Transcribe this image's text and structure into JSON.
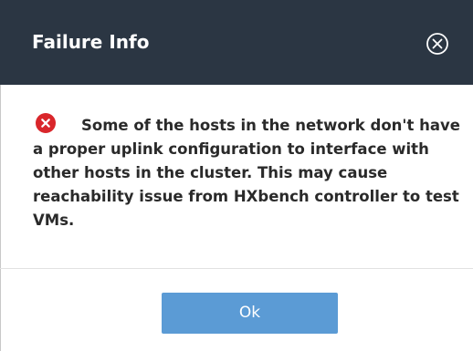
{
  "dialog": {
    "title": "Failure Info",
    "close_icon": "circle-x-icon",
    "message": "Some of the hosts in the network don't have a proper uplink configuration to interface with other hosts in the cluster. This may cause reachability issue from HXbench controller to test VMs.",
    "message_icon": "error-icon",
    "ok_label": "Ok"
  },
  "colors": {
    "header_background": "#2b3643",
    "header_text": "#ffffff",
    "error_red": "#d9262b",
    "button_blue": "#5b9bd5",
    "message_text": "#2a2a2a"
  }
}
